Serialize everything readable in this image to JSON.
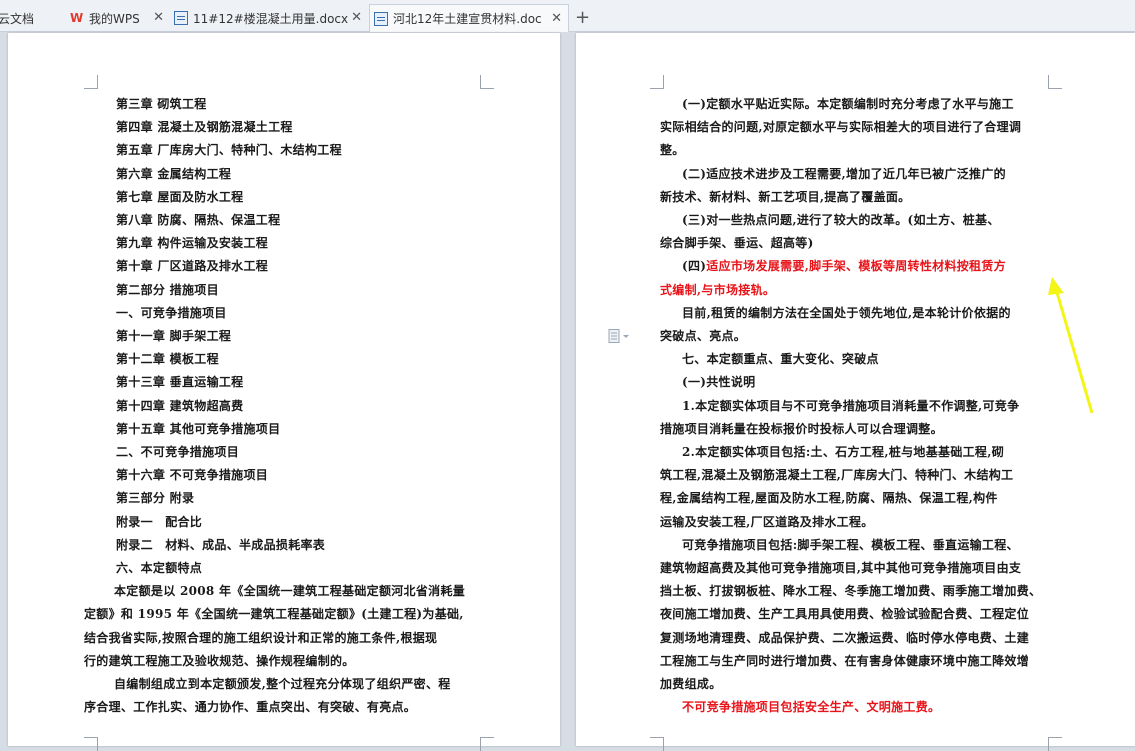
{
  "tabs": [
    {
      "label": "云文档",
      "icon": "doc-icon"
    },
    {
      "label": "我的WPS",
      "icon": "wps-logo-icon"
    },
    {
      "label": "11#12#楼混凝土用量.docx",
      "icon": "doc-icon"
    },
    {
      "label": "河北12年土建宣贯材料.doc",
      "icon": "doc-icon",
      "active": true
    }
  ],
  "left_page": {
    "lines": [
      "第三章 砌筑工程",
      "第四章 混凝土及钢筋混凝土工程",
      "第五章 厂库房大门、特种门、木结构工程",
      "第六章 金属结构工程",
      "第七章 屋面及防水工程",
      "第八章 防腐、隔热、保温工程",
      "第九章 构件运输及安装工程",
      "第十章 厂区道路及排水工程",
      "第二部分 措施项目",
      "一、可竞争措施项目",
      "第十一章 脚手架工程",
      "第十二章 模板工程",
      "第十三章 垂直运输工程",
      "第十四章 建筑物超高费",
      "第十五章 其他可竞争措施项目",
      "二、不可竞争措施项目",
      "第十六章 不可竞争措施项目",
      "第三部分 附录",
      "附录一　配合比",
      "附录二　材料、成品、半成品损耗率表",
      "六、本定额特点",
      "本定额是以 2008 年《全国统一建筑工程基础定额河北省消耗量",
      "定额》和 1995 年《全国统一建筑工程基础定额》(土建工程)为基础,",
      "结合我省实际,按照合理的施工组织设计和正常的施工条件,根据现",
      "行的建筑工程施工及验收规范、操作规程编制的。",
      "自编制组成立到本定额颁发,整个过程充分体现了组织严密、程",
      "序合理、工作扎实、通力协作、重点突出、有突破、有亮点。"
    ]
  },
  "right_page": {
    "lines": [
      {
        "text": "(一)定额水平贴近实际。本定额编制时充分考虑了水平与施工",
        "color": "black"
      },
      {
        "text": "实际相结合的问题,对原定额水平与实际相差大的项目进行了合理调",
        "color": "black"
      },
      {
        "text": "整。",
        "color": "black"
      },
      {
        "text": "(二)适应技术进步及工程需要,增加了近几年已被广泛推广的",
        "color": "black"
      },
      {
        "text": "新技术、新材料、新工艺项目,提高了覆盖面。",
        "color": "black"
      },
      {
        "text": "(三)对一些热点问题,进行了较大的改革。(如土方、桩基、",
        "color": "black"
      },
      {
        "text": "综合脚手架、垂运、超高等)",
        "color": "black"
      },
      {
        "text_black": "(四)",
        "text_red": "适应市场发展需要,脚手架、模板等周转性材料按租赁方",
        "color": "mixed"
      },
      {
        "text": "式编制,与市场接轨。",
        "color": "red"
      },
      {
        "text": "目前,租赁的编制方法在全国处于领先地位,是本轮计价依据的",
        "color": "black"
      },
      {
        "text": "突破点、亮点。",
        "color": "black"
      },
      {
        "text": "七、本定额重点、重大变化、突破点",
        "color": "black"
      },
      {
        "text": "(一)共性说明",
        "color": "black"
      },
      {
        "text": "1.本定额实体项目与不可竞争措施项目消耗量不作调整,可竞争",
        "color": "black"
      },
      {
        "text": "措施项目消耗量在投标报价时投标人可以合理调整。",
        "color": "black"
      },
      {
        "text": "2.本定额实体项目包括:土、石方工程,桩与地基基础工程,砌",
        "color": "black"
      },
      {
        "text": "筑工程,混凝土及钢筋混凝土工程,厂库房大门、特种门、木结构工",
        "color": "black"
      },
      {
        "text": "程,金属结构工程,屋面及防水工程,防腐、隔热、保温工程,构件",
        "color": "black"
      },
      {
        "text": "运输及安装工程,厂区道路及排水工程。",
        "color": "black"
      },
      {
        "text": "可竞争措施项目包括:脚手架工程、模板工程、垂直运输工程、",
        "color": "black"
      },
      {
        "text": "建筑物超高费及其他可竞争措施项目,其中其他可竞争措施项目由支",
        "color": "black"
      },
      {
        "text": "挡土板、打拔钢板桩、降水工程、冬季施工增加费、雨季施工增加费、",
        "color": "black"
      },
      {
        "text": "夜间施工增加费、生产工具用具使用费、检验试验配合费、工程定位",
        "color": "black"
      },
      {
        "text": "复测场地清理费、成品保护费、二次搬运费、临时停水停电费、土建",
        "color": "black"
      },
      {
        "text": "工程施工与生产同时进行增加费、在有害身体健康环境中施工降效增",
        "color": "black"
      },
      {
        "text": "加费组成。",
        "color": "black"
      },
      {
        "text": "不可竞争措施项目包括安全生产、文明施工费。",
        "color": "red"
      }
    ]
  },
  "colors": {
    "accent_red": "#e8141a",
    "arrow": "#f3f516"
  }
}
